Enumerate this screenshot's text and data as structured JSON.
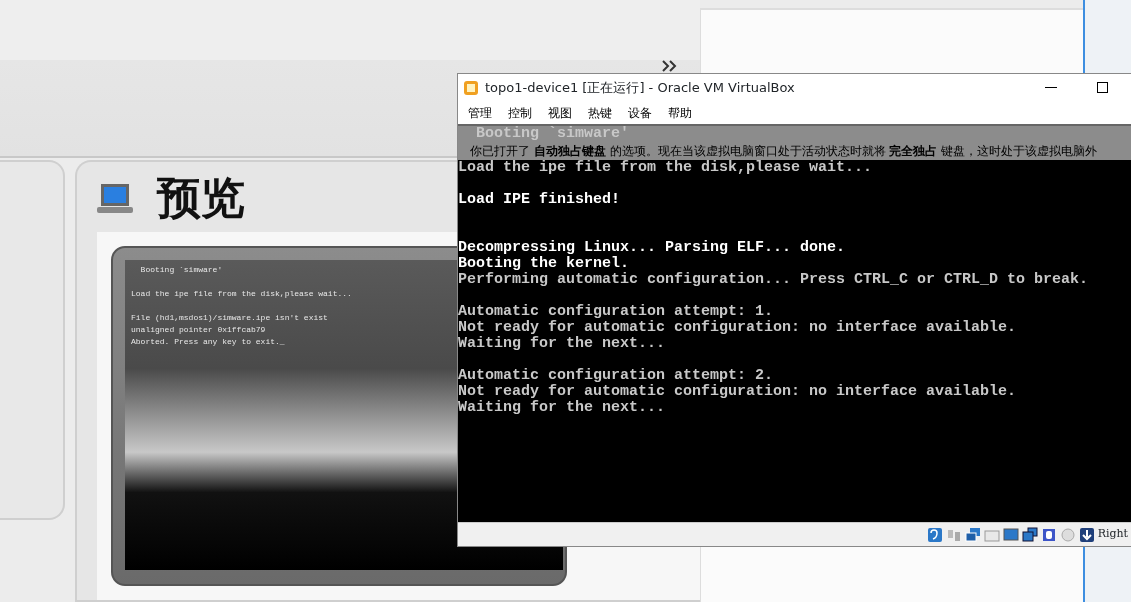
{
  "manager": {
    "preview": {
      "title": "预览",
      "lines": [
        {
          "kind": "text",
          "text": "  Booting `simware'"
        },
        {
          "kind": "blank"
        },
        {
          "kind": "text",
          "text": "Load the ipe file from the disk,please wait..."
        },
        {
          "kind": "blank"
        },
        {
          "kind": "text",
          "text": "File (hd1,msdos1)/simware.ipe isn't exist"
        },
        {
          "kind": "text",
          "text": "unaligned pointer 0x1ffcab79"
        },
        {
          "kind": "text",
          "text": "Aborted. Press any key to exit._"
        }
      ]
    }
  },
  "vm_window": {
    "title": "topo1-device1 [正在运行] - Oracle VM VirtualBox",
    "menu": [
      "管理",
      "控制",
      "视图",
      "热键",
      "设备",
      "帮助"
    ],
    "notice": "你已打开了 **自动独占键盘** 的选项。现在当该虚拟电脑窗口处于活动状态时就将 **完全独占** 键盘，这时处于该虚拟电脑外",
    "console_top": [
      {
        "kind": "text",
        "text": "  Booting `simware'",
        "bright": false
      }
    ],
    "console": [
      {
        "kind": "text",
        "text": "Load the ipe file from the disk,please wait...",
        "bright": false
      },
      {
        "kind": "blank"
      },
      {
        "kind": "text",
        "text": "Load IPE finished!",
        "bright": true
      },
      {
        "kind": "blank"
      },
      {
        "kind": "blank"
      },
      {
        "kind": "text",
        "text": "Decompressing Linux... Parsing ELF... done.",
        "bright": true
      },
      {
        "kind": "text",
        "text": "Booting the kernel.",
        "bright": true
      },
      {
        "kind": "text",
        "text": "Performing automatic configuration... Press CTRL_C or CTRL_D to break.",
        "bright": false
      },
      {
        "kind": "blank"
      },
      {
        "kind": "text",
        "text": "Automatic configuration attempt: 1.",
        "bright": false
      },
      {
        "kind": "text",
        "text": "Not ready for automatic configuration: no interface available.",
        "bright": false
      },
      {
        "kind": "text",
        "text": "Waiting for the next...",
        "bright": false
      },
      {
        "kind": "blank"
      },
      {
        "kind": "text",
        "text": "Automatic configuration attempt: 2.",
        "bright": false
      },
      {
        "kind": "text",
        "text": "Not ready for automatic configuration: no interface available.",
        "bright": false
      },
      {
        "kind": "text",
        "text": "Waiting for the next...",
        "bright": false
      }
    ],
    "host_key": "Right"
  }
}
